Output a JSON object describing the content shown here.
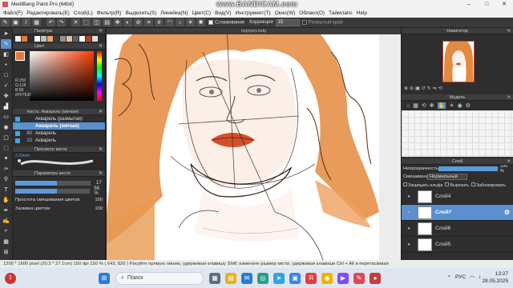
{
  "app": {
    "title": "MediBang Paint Pro (64bit)",
    "recorder_watermark": "www.BANDICAM.com"
  },
  "menu": [
    "Файл(F)",
    "Редактировать(E)",
    "Слой(L)",
    "Фильтр(R)",
    "Выделить(S)",
    "Линейка(N)",
    "Цвет(C)",
    "Вид(V)",
    "Инструмент(T)",
    "Окно(W)",
    "Облако(O)",
    "Таймлапс",
    "Help"
  ],
  "toolbar": {
    "smoothing_label": "Сглаживание",
    "correction_label": "Коррекция",
    "correction_value": "15",
    "blur_edge_label": "Размытый край"
  },
  "palette": {
    "title": "Палитра",
    "swatches": [
      "#f2f2f2",
      "#e07a3a",
      "#2b2b2b",
      "#ffffff",
      "#c0c0c0",
      "#f0a070",
      "#3a3a3a",
      "#909090",
      "#e8c0a0",
      "#606060",
      "#ffffff",
      "#b04020",
      "#dddddd"
    ]
  },
  "color": {
    "title": "Цвет",
    "current": "#e07a3a",
    "r": "R:250",
    "g": "G:118",
    "b": "B:58",
    "hex": "#FF763F"
  },
  "brush": {
    "title": "Кисть: Акварель (мягкая)",
    "items": [
      {
        "num": "",
        "label": "Акварель (размытая)",
        "selected": false
      },
      {
        "num": "",
        "label": "Акварель (мягкая)",
        "selected": true
      },
      {
        "num": "80",
        "label": "Акварель",
        "selected": false
      },
      {
        "num": "23",
        "label": "Акварель",
        "selected": false
      }
    ]
  },
  "brush_preview": {
    "title": "Просмотр кисти",
    "size": "2.99mm"
  },
  "brush_params": {
    "title": "Параметры кисти",
    "size_value": "17",
    "size_fill": 0.55,
    "opacity_value": "56 %",
    "opacity_fill": 0.56,
    "blend_label": "Простота смешивания цветов",
    "blend_value": "100",
    "fill_label": "Заливка цветом",
    "fill_value": "100"
  },
  "canvas": {
    "title": "портрет.mdp"
  },
  "navigator": {
    "title": "Навигатор"
  },
  "model": {
    "title": "Модель"
  },
  "layers": {
    "title": "Слой",
    "opacity_label": "Непрозрачность",
    "opacity_value": "100 %",
    "opacity_fill": 1.0,
    "blend_label": "Смешивание",
    "blend_value": "Нормальный",
    "protect_alpha": "Защищать альфа",
    "cut": "Вырезать",
    "lock": "Заблокировать",
    "items": [
      {
        "name": "Слой4",
        "selected": false
      },
      {
        "name": "Слой7",
        "selected": true
      },
      {
        "name": "Слой6",
        "selected": false
      },
      {
        "name": "Слой5",
        "selected": false
      }
    ]
  },
  "status": {
    "text": "1200 * 1600 pixel  (20.3 * 27.1cm)  150 dpi  150 %  ( 643, 820 )  Рисуйте прямую линию, удерживая клавишу Shift; измените размер кисти, удерживая клавиши Ctrl + Alt и перетаскивая"
  },
  "taskbar": {
    "search_placeholder": "Поиск",
    "notification_count": "1",
    "lang": "РУС",
    "time": "13:27",
    "date": "28.05.2025"
  }
}
